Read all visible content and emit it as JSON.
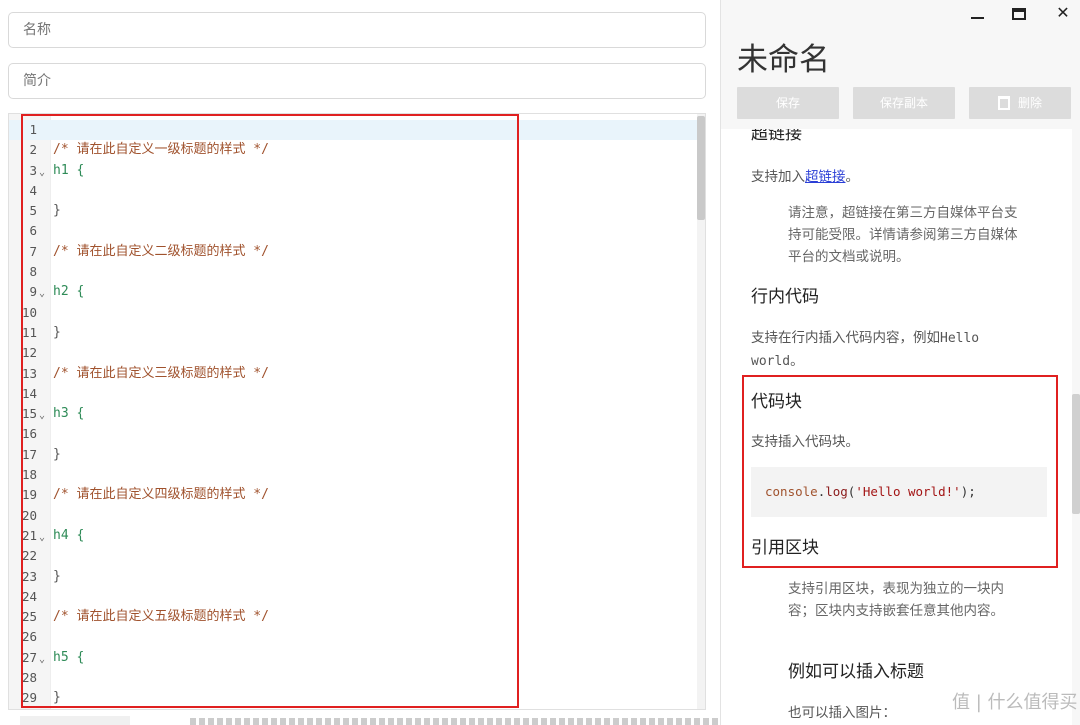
{
  "form": {
    "name_placeholder": "名称",
    "desc_placeholder": "简介"
  },
  "editor": {
    "lines": [
      {
        "n": "1",
        "text": "",
        "kind": "plain",
        "fold": false,
        "active": true
      },
      {
        "n": "2",
        "text": "/* 请在此自定义一级标题的样式 */",
        "kind": "comment",
        "fold": false
      },
      {
        "n": "3",
        "text": "h1 {",
        "kind": "selector",
        "fold": true
      },
      {
        "n": "4",
        "text": "",
        "kind": "plain",
        "fold": false
      },
      {
        "n": "5",
        "text": "}",
        "kind": "brace",
        "fold": false
      },
      {
        "n": "6",
        "text": "",
        "kind": "plain",
        "fold": false
      },
      {
        "n": "7",
        "text": "/* 请在此自定义二级标题的样式 */",
        "kind": "comment",
        "fold": false
      },
      {
        "n": "8",
        "text": "",
        "kind": "plain",
        "fold": false
      },
      {
        "n": "9",
        "text": "h2 {",
        "kind": "selector",
        "fold": true
      },
      {
        "n": "10",
        "text": "",
        "kind": "plain",
        "fold": false
      },
      {
        "n": "11",
        "text": "}",
        "kind": "brace",
        "fold": false
      },
      {
        "n": "12",
        "text": "",
        "kind": "plain",
        "fold": false
      },
      {
        "n": "13",
        "text": "/* 请在此自定义三级标题的样式 */",
        "kind": "comment",
        "fold": false
      },
      {
        "n": "14",
        "text": "",
        "kind": "plain",
        "fold": false
      },
      {
        "n": "15",
        "text": "h3 {",
        "kind": "selector",
        "fold": true
      },
      {
        "n": "16",
        "text": "",
        "kind": "plain",
        "fold": false
      },
      {
        "n": "17",
        "text": "}",
        "kind": "brace",
        "fold": false
      },
      {
        "n": "18",
        "text": "",
        "kind": "plain",
        "fold": false
      },
      {
        "n": "19",
        "text": "/* 请在此自定义四级标题的样式 */",
        "kind": "comment",
        "fold": false
      },
      {
        "n": "20",
        "text": "",
        "kind": "plain",
        "fold": false
      },
      {
        "n": "21",
        "text": "h4 {",
        "kind": "selector",
        "fold": true
      },
      {
        "n": "22",
        "text": "",
        "kind": "plain",
        "fold": false
      },
      {
        "n": "23",
        "text": "}",
        "kind": "brace",
        "fold": false
      },
      {
        "n": "24",
        "text": "",
        "kind": "plain",
        "fold": false
      },
      {
        "n": "25",
        "text": "/* 请在此自定义五级标题的样式 */",
        "kind": "comment",
        "fold": false
      },
      {
        "n": "26",
        "text": "",
        "kind": "plain",
        "fold": false
      },
      {
        "n": "27",
        "text": "h5 {",
        "kind": "selector",
        "fold": true
      },
      {
        "n": "28",
        "text": "",
        "kind": "plain",
        "fold": false
      },
      {
        "n": "29",
        "text": "}",
        "kind": "brace",
        "fold": false
      }
    ]
  },
  "window": {
    "title": "未命名"
  },
  "actions": {
    "save": "保存",
    "save_copy": "保存副本",
    "delete": "删除"
  },
  "preview": {
    "hyperlink_heading": "超链接",
    "hyperlink_prefix": "支持加入",
    "hyperlink_link": "超链接",
    "hyperlink_suffix": "。",
    "hyperlink_quote": "请注意，超链接在第三方自媒体平台支持可能受限。详情请参阅第三方自媒体平台的文档或说明。",
    "inline_heading": "行内代码",
    "inline_text1": "支持在行内插入代码内容，例如",
    "inline_code1": "Hello",
    "inline_code2": "world",
    "inline_text2": "。",
    "codeblock_heading": "代码块",
    "codeblock_text": "支持插入代码块。",
    "code": {
      "obj": "console",
      "dot": ".",
      "fn": "log",
      "open": "(",
      "str": "'Hello world!'",
      "close": ");"
    },
    "quote_heading": "引用区块",
    "quote_text": "支持引用区块，表现为独立的一块内容；区块内支持嵌套任意其他内容。",
    "example_heading": "例如可以插入标题",
    "image_text": "也可以插入图片："
  },
  "watermark": "值 | 什么值得买"
}
